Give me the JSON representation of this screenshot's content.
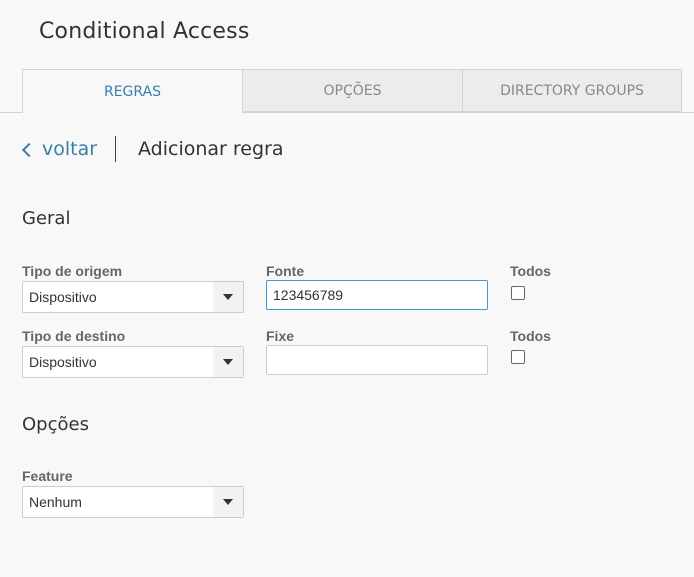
{
  "header": {
    "title": "Conditional Access"
  },
  "tabs": [
    {
      "label": "REGRAS",
      "active": true
    },
    {
      "label": "OPÇÕES",
      "active": false
    },
    {
      "label": "DIRECTORY GROUPS",
      "active": false
    }
  ],
  "nav": {
    "back_label": "voltar",
    "page_title": "Adicionar regra"
  },
  "geral": {
    "title": "Geral",
    "source_type": {
      "label": "Tipo de origem",
      "value": "Dispositivo"
    },
    "source": {
      "label": "Fonte",
      "value": "123456789",
      "placeholder": ""
    },
    "source_all": {
      "label": "Todos",
      "checked": false
    },
    "dest_type": {
      "label": "Tipo de destino",
      "value": "Dispositivo"
    },
    "dest": {
      "label": "Fixe",
      "value": "",
      "placeholder": ""
    },
    "dest_all": {
      "label": "Todos",
      "checked": false
    }
  },
  "opcoes": {
    "title": "Opções",
    "feature": {
      "label": "Feature",
      "value": "Nenhum"
    }
  },
  "colors": {
    "accent": "#3a7fa6",
    "focus_border": "#3a9bc9",
    "background": "#f8f8f8"
  }
}
